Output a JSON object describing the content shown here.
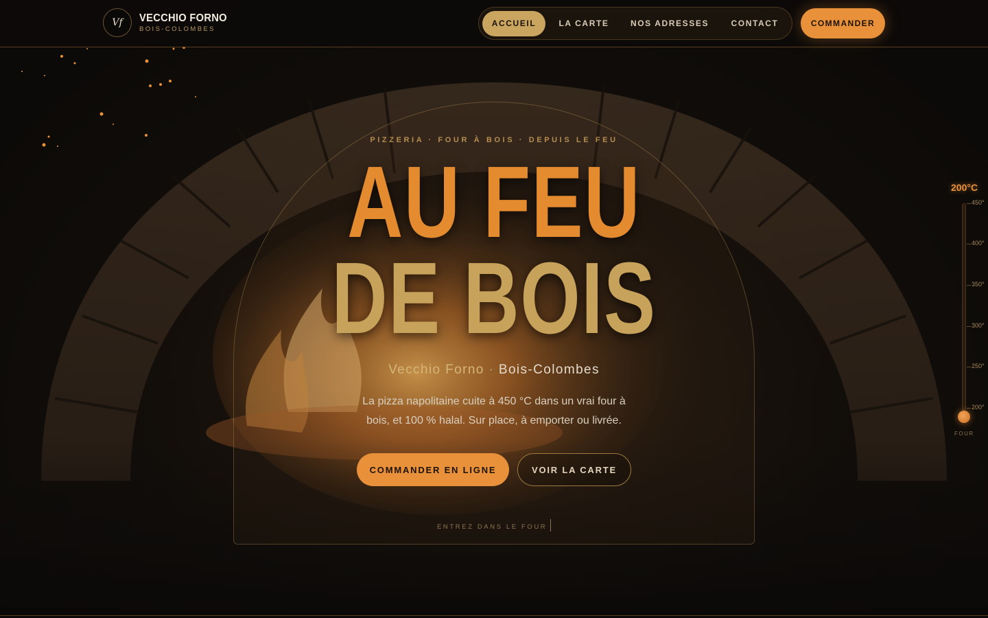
{
  "header": {
    "logo_monogram": "Vf",
    "brand_name": "VECCHIO FORNO",
    "brand_location": "BOIS-COLOMBES",
    "nav": [
      {
        "label": "ACCUEIL",
        "active": true
      },
      {
        "label": "LA CARTE",
        "active": false
      },
      {
        "label": "NOS ADRESSES",
        "active": false
      },
      {
        "label": "CONTACT",
        "active": false
      }
    ],
    "order_button": "COMMANDER"
  },
  "hero": {
    "eyebrow": "PIZZERIA · FOUR À BOIS · DEPUIS LE FEU",
    "headline_line1": "AU FEU",
    "headline_line2": "DE BOIS",
    "subtitle_name": "Vecchio Forno",
    "subtitle_sep": "·",
    "subtitle_city": "Bois-Colombes",
    "description": "La pizza napolitaine cuite à 450 °C dans un vrai four à bois, et 100 % halal. Sur place, à emporter ou livrée.",
    "primary_button": "COMMANDER EN LIGNE",
    "secondary_button": "VOIR LA CARTE",
    "enter_hint": "ENTREZ DANS LE FOUR"
  },
  "thermometer": {
    "current": "200°C",
    "fill_fraction": 0,
    "scale": [
      "450°",
      "400°",
      "350°",
      "300°",
      "250°",
      "200°"
    ],
    "caption": "FOUR"
  },
  "colors": {
    "accent_orange": "#e8913a",
    "accent_gold": "#c9a560",
    "background": "#0e0c0a"
  },
  "icons": {
    "logo": "vf-monogram-icon",
    "thermometer": "thermometer-icon"
  }
}
